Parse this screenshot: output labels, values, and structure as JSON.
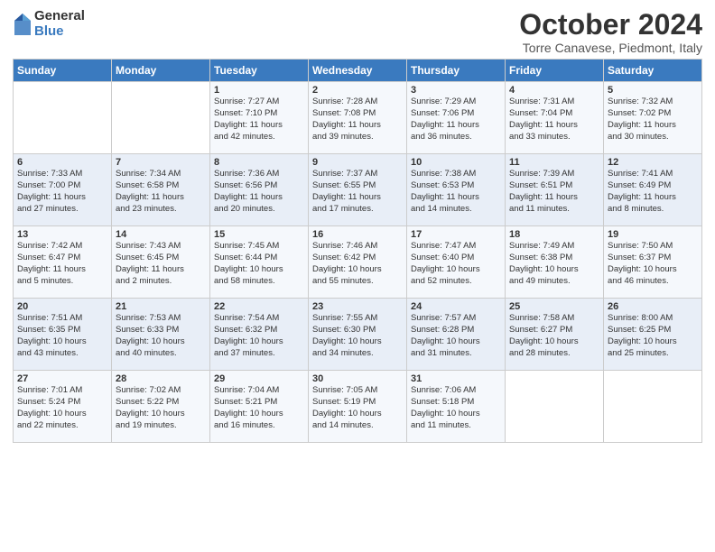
{
  "logo": {
    "general": "General",
    "blue": "Blue"
  },
  "title": "October 2024",
  "location": "Torre Canavese, Piedmont, Italy",
  "days_header": [
    "Sunday",
    "Monday",
    "Tuesday",
    "Wednesday",
    "Thursday",
    "Friday",
    "Saturday"
  ],
  "weeks": [
    [
      {
        "day": "",
        "info": ""
      },
      {
        "day": "",
        "info": ""
      },
      {
        "day": "1",
        "info": "Sunrise: 7:27 AM\nSunset: 7:10 PM\nDaylight: 11 hours\nand 42 minutes."
      },
      {
        "day": "2",
        "info": "Sunrise: 7:28 AM\nSunset: 7:08 PM\nDaylight: 11 hours\nand 39 minutes."
      },
      {
        "day": "3",
        "info": "Sunrise: 7:29 AM\nSunset: 7:06 PM\nDaylight: 11 hours\nand 36 minutes."
      },
      {
        "day": "4",
        "info": "Sunrise: 7:31 AM\nSunset: 7:04 PM\nDaylight: 11 hours\nand 33 minutes."
      },
      {
        "day": "5",
        "info": "Sunrise: 7:32 AM\nSunset: 7:02 PM\nDaylight: 11 hours\nand 30 minutes."
      }
    ],
    [
      {
        "day": "6",
        "info": "Sunrise: 7:33 AM\nSunset: 7:00 PM\nDaylight: 11 hours\nand 27 minutes."
      },
      {
        "day": "7",
        "info": "Sunrise: 7:34 AM\nSunset: 6:58 PM\nDaylight: 11 hours\nand 23 minutes."
      },
      {
        "day": "8",
        "info": "Sunrise: 7:36 AM\nSunset: 6:56 PM\nDaylight: 11 hours\nand 20 minutes."
      },
      {
        "day": "9",
        "info": "Sunrise: 7:37 AM\nSunset: 6:55 PM\nDaylight: 11 hours\nand 17 minutes."
      },
      {
        "day": "10",
        "info": "Sunrise: 7:38 AM\nSunset: 6:53 PM\nDaylight: 11 hours\nand 14 minutes."
      },
      {
        "day": "11",
        "info": "Sunrise: 7:39 AM\nSunset: 6:51 PM\nDaylight: 11 hours\nand 11 minutes."
      },
      {
        "day": "12",
        "info": "Sunrise: 7:41 AM\nSunset: 6:49 PM\nDaylight: 11 hours\nand 8 minutes."
      }
    ],
    [
      {
        "day": "13",
        "info": "Sunrise: 7:42 AM\nSunset: 6:47 PM\nDaylight: 11 hours\nand 5 minutes."
      },
      {
        "day": "14",
        "info": "Sunrise: 7:43 AM\nSunset: 6:45 PM\nDaylight: 11 hours\nand 2 minutes."
      },
      {
        "day": "15",
        "info": "Sunrise: 7:45 AM\nSunset: 6:44 PM\nDaylight: 10 hours\nand 58 minutes."
      },
      {
        "day": "16",
        "info": "Sunrise: 7:46 AM\nSunset: 6:42 PM\nDaylight: 10 hours\nand 55 minutes."
      },
      {
        "day": "17",
        "info": "Sunrise: 7:47 AM\nSunset: 6:40 PM\nDaylight: 10 hours\nand 52 minutes."
      },
      {
        "day": "18",
        "info": "Sunrise: 7:49 AM\nSunset: 6:38 PM\nDaylight: 10 hours\nand 49 minutes."
      },
      {
        "day": "19",
        "info": "Sunrise: 7:50 AM\nSunset: 6:37 PM\nDaylight: 10 hours\nand 46 minutes."
      }
    ],
    [
      {
        "day": "20",
        "info": "Sunrise: 7:51 AM\nSunset: 6:35 PM\nDaylight: 10 hours\nand 43 minutes."
      },
      {
        "day": "21",
        "info": "Sunrise: 7:53 AM\nSunset: 6:33 PM\nDaylight: 10 hours\nand 40 minutes."
      },
      {
        "day": "22",
        "info": "Sunrise: 7:54 AM\nSunset: 6:32 PM\nDaylight: 10 hours\nand 37 minutes."
      },
      {
        "day": "23",
        "info": "Sunrise: 7:55 AM\nSunset: 6:30 PM\nDaylight: 10 hours\nand 34 minutes."
      },
      {
        "day": "24",
        "info": "Sunrise: 7:57 AM\nSunset: 6:28 PM\nDaylight: 10 hours\nand 31 minutes."
      },
      {
        "day": "25",
        "info": "Sunrise: 7:58 AM\nSunset: 6:27 PM\nDaylight: 10 hours\nand 28 minutes."
      },
      {
        "day": "26",
        "info": "Sunrise: 8:00 AM\nSunset: 6:25 PM\nDaylight: 10 hours\nand 25 minutes."
      }
    ],
    [
      {
        "day": "27",
        "info": "Sunrise: 7:01 AM\nSunset: 5:24 PM\nDaylight: 10 hours\nand 22 minutes."
      },
      {
        "day": "28",
        "info": "Sunrise: 7:02 AM\nSunset: 5:22 PM\nDaylight: 10 hours\nand 19 minutes."
      },
      {
        "day": "29",
        "info": "Sunrise: 7:04 AM\nSunset: 5:21 PM\nDaylight: 10 hours\nand 16 minutes."
      },
      {
        "day": "30",
        "info": "Sunrise: 7:05 AM\nSunset: 5:19 PM\nDaylight: 10 hours\nand 14 minutes."
      },
      {
        "day": "31",
        "info": "Sunrise: 7:06 AM\nSunset: 5:18 PM\nDaylight: 10 hours\nand 11 minutes."
      },
      {
        "day": "",
        "info": ""
      },
      {
        "day": "",
        "info": ""
      }
    ]
  ]
}
